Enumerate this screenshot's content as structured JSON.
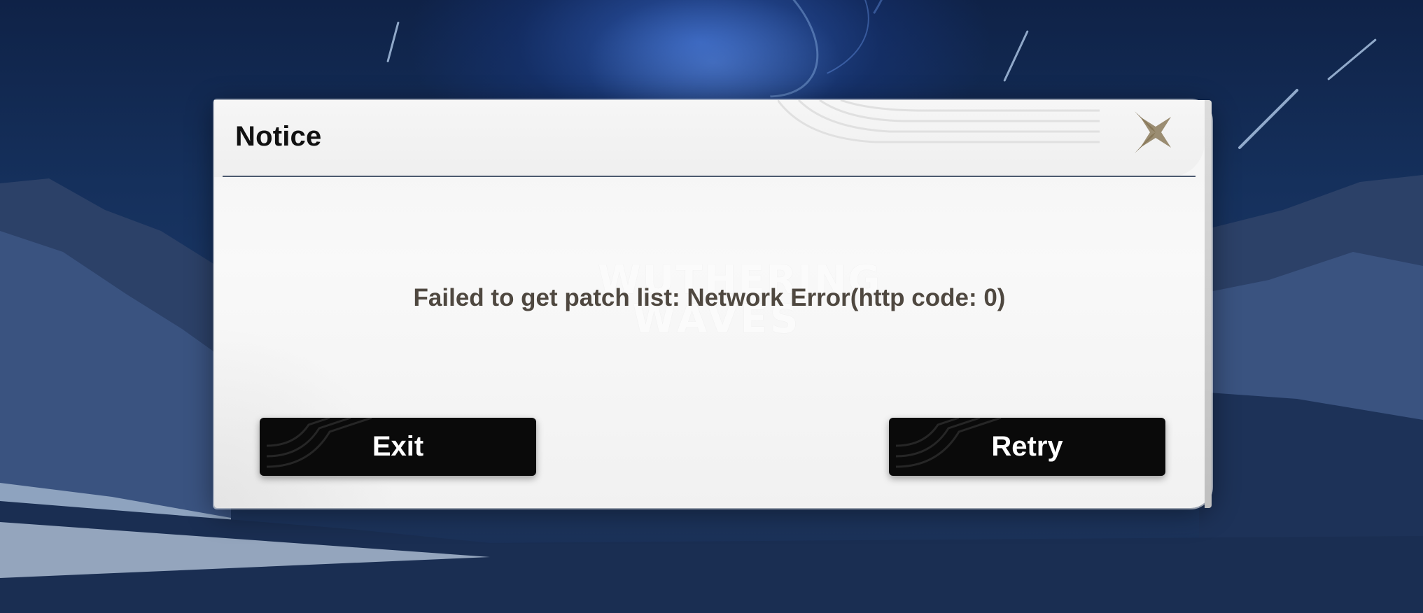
{
  "dialog": {
    "title": "Notice",
    "message": "Failed to get patch list: Network Error(http code: 0)",
    "watermark_line1": "WUTHERING",
    "watermark_line2": "WAVES",
    "close_icon": "close-x-icon",
    "buttons": {
      "exit_label": "Exit",
      "retry_label": "Retry"
    }
  },
  "colors": {
    "dialog_background": "#f4f4f4",
    "divider": "#4c5a6f",
    "message_text": "#4f4840",
    "button_background": "#0a0a0a",
    "button_text": "#ffffff",
    "close_icon": "#7a6a4e"
  }
}
